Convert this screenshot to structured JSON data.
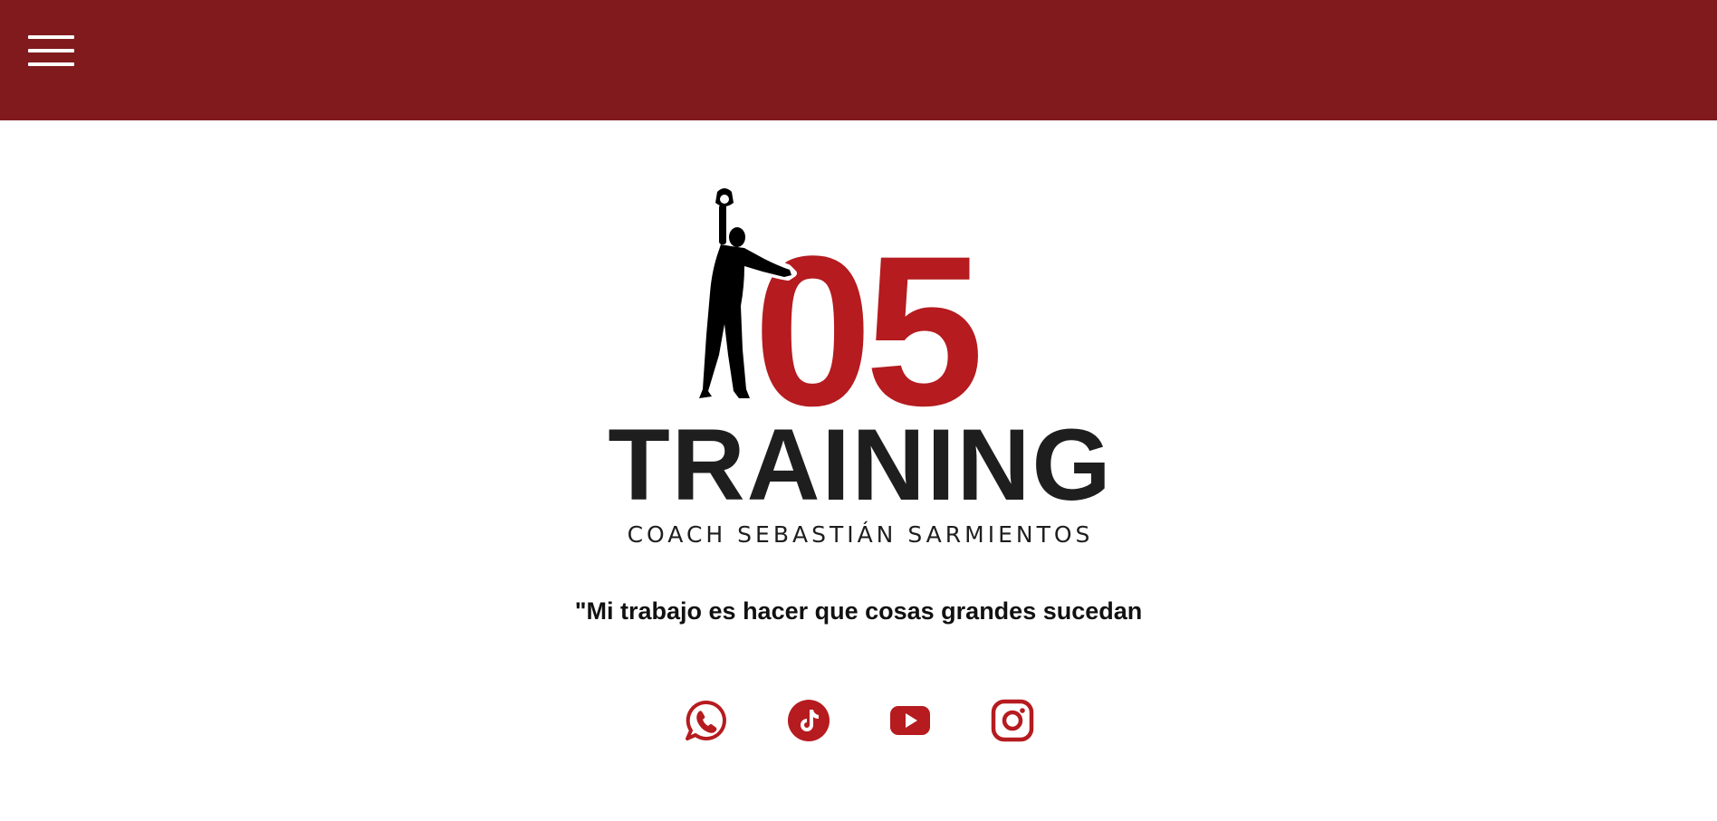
{
  "header": {
    "menu_icon": "hamburger-menu-icon",
    "background_color": "#801a1d"
  },
  "logo": {
    "number": "05",
    "word": "TRAINING",
    "subtitle": "COACH SEBASTIÁN SARMIENTOS",
    "figure_icon": "kettlebell-athlete-silhouette",
    "accent_color": "#b51b1f",
    "text_color": "#1e1e1e"
  },
  "quote": "\"Mi trabajo es hacer que cosas grandes sucedan",
  "social": [
    {
      "name": "whatsapp",
      "icon": "whatsapp-icon"
    },
    {
      "name": "tiktok",
      "icon": "tiktok-icon"
    },
    {
      "name": "youtube",
      "icon": "youtube-icon"
    },
    {
      "name": "instagram",
      "icon": "instagram-icon"
    }
  ],
  "colors": {
    "brand_red": "#b51b1f",
    "header_red": "#801a1d",
    "background": "#ffffff"
  }
}
